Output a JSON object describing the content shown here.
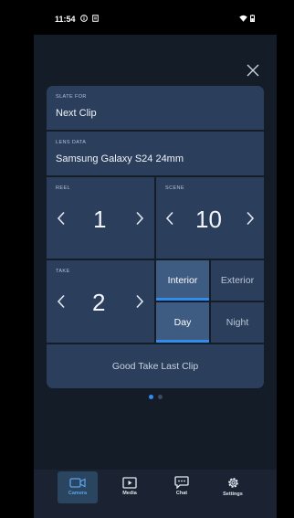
{
  "status_bar": {
    "time": "11:54"
  },
  "slate": {
    "slate_for_label": "SLATE FOR",
    "slate_for_value": "Next Clip",
    "lens_label": "LENS DATA",
    "lens_value": "Samsung Galaxy S24 24mm",
    "reel_label": "REEL",
    "reel_value": "1",
    "scene_label": "SCENE",
    "scene_value": "10",
    "take_label": "TAKE",
    "take_value": "2",
    "interior_label": "Interior",
    "exterior_label": "Exterior",
    "day_label": "Day",
    "night_label": "Night",
    "good_take_label": "Good Take Last Clip"
  },
  "pager": {
    "pages": 2,
    "current": 1
  },
  "bottom_nav": {
    "camera": "Camera",
    "media": "Media",
    "chat": "Chat",
    "settings": "Settings"
  },
  "colors": {
    "accent": "#2f8df2",
    "cell": "#2b3f5c",
    "cell_active": "#3e5b82",
    "background": "#141c28"
  }
}
